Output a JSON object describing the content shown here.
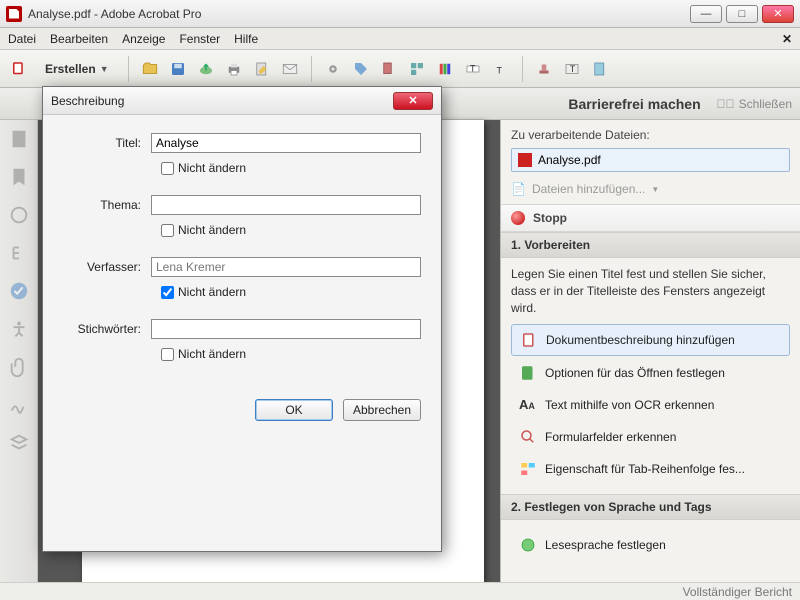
{
  "titlebar": {
    "text": "Analyse.pdf - Adobe Acrobat Pro"
  },
  "menus": {
    "datei": "Datei",
    "bearbeiten": "Bearbeiten",
    "anzeige": "Anzeige",
    "fenster": "Fenster",
    "hilfe": "Hilfe"
  },
  "toolbar": {
    "erstellen": "Erstellen"
  },
  "panel_header": {
    "title": "Barrierefrei machen",
    "close": "Schließen"
  },
  "right": {
    "files_label": "Zu verarbeitende Dateien:",
    "filename": "Analyse.pdf",
    "add_files": "Dateien hinzufügen...",
    "stop": "Stopp",
    "step1_header": "1. Vorbereiten",
    "step1_instr": "Legen Sie einen Titel fest und stellen Sie sicher, dass er in der Titelleiste des Fensters angezeigt wird.",
    "tasks": {
      "desc": "Dokumentbeschreibung hinzufügen",
      "open": "Optionen für das Öffnen festlegen",
      "ocr": "Text mithilfe von OCR erkennen",
      "form": "Formularfelder erkennen",
      "tab": "Eigenschaft für Tab-Reihenfolge fes...",
      "step2": "2. Festlegen von Sprache und Tags",
      "lang": "Lesesprache festlegen"
    }
  },
  "dialog": {
    "title": "Beschreibung",
    "titel_label": "Titel:",
    "titel_value": "Analyse",
    "thema_label": "Thema:",
    "thema_value": "",
    "verfasser_label": "Verfasser:",
    "verfasser_value": "Lena Kremer",
    "stich_label": "Stichwörter:",
    "stich_value": "",
    "nicht_aendern": "Nicht ändern",
    "ok": "OK",
    "cancel": "Abbrechen"
  },
  "status": {
    "text": "Vollständiger Bericht"
  }
}
